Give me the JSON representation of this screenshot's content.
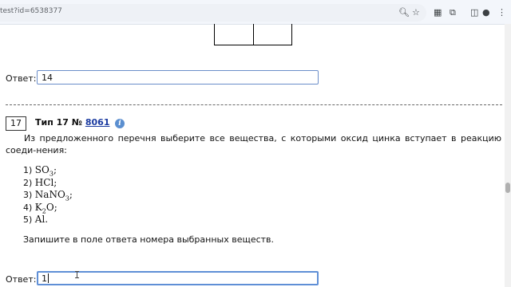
{
  "browser": {
    "url": "test?id=6538377",
    "icons": [
      "zoom-icon",
      "star-icon",
      "extension-icon",
      "puzzle-icon",
      "sidebar-icon",
      "profile-icon",
      "menu-icon"
    ]
  },
  "prev_answer": {
    "label": "Ответ:",
    "value": "14"
  },
  "task": {
    "number": "17",
    "type_label": "Тип 17 №",
    "id_link": "8061",
    "info_glyph": "i",
    "question": "Из предложенного перечня выберите все вещества, с которыми оксид цинка вступает в реакцию соеди-нения:",
    "options": [
      {
        "num": "1)",
        "parts": [
          [
            "SO",
            ""
          ],
          [
            "3",
            "sub"
          ],
          [
            ";",
            ""
          ]
        ]
      },
      {
        "num": "2)",
        "parts": [
          [
            "HCl;",
            ""
          ]
        ]
      },
      {
        "num": "3)",
        "parts": [
          [
            "NaNO",
            ""
          ],
          [
            "3",
            "sub"
          ],
          [
            ";",
            ""
          ]
        ]
      },
      {
        "num": "4)",
        "parts": [
          [
            "K",
            ""
          ],
          [
            "2",
            "sub"
          ],
          [
            "O;",
            ""
          ]
        ]
      },
      {
        "num": "5)",
        "parts": [
          [
            "Al.",
            ""
          ]
        ]
      }
    ],
    "instruction": "Запишите в поле ответа номера выбранных веществ.",
    "answer_label": "Ответ:",
    "answer_value": "1"
  }
}
